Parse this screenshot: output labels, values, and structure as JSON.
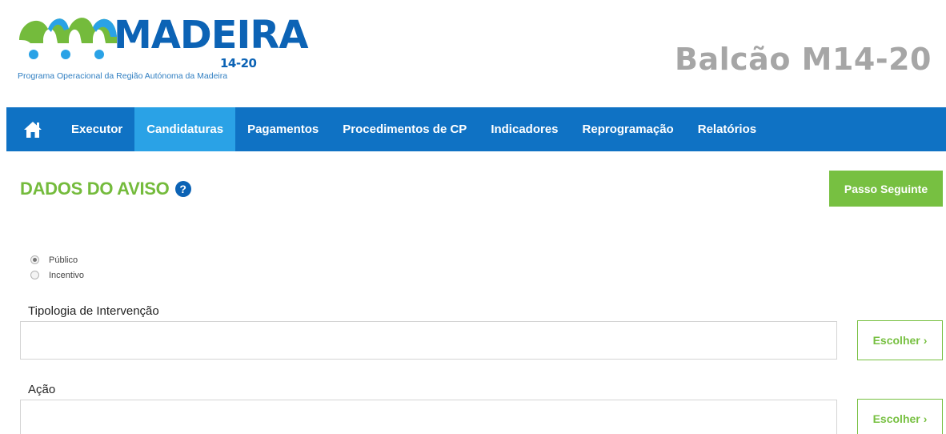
{
  "header": {
    "logo_text": "MADEIRA",
    "logo_years": "14-20",
    "logo_subtitle": "Programa Operacional da Região Autónoma da Madeira",
    "app_title": "Balcão M14-20"
  },
  "nav": {
    "items": [
      {
        "label": "Executor"
      },
      {
        "label": "Candidaturas",
        "active": true
      },
      {
        "label": "Pagamentos"
      },
      {
        "label": "Procedimentos de CP"
      },
      {
        "label": "Indicadores"
      },
      {
        "label": "Reprogramação"
      },
      {
        "label": "Relatórios"
      }
    ]
  },
  "section": {
    "title": "DADOS DO AVISO",
    "help_glyph": "?",
    "next_button": "Passo Seguinte"
  },
  "radios": [
    {
      "label": "Público",
      "checked": true
    },
    {
      "label": "Incentivo",
      "checked": false
    }
  ],
  "fields": [
    {
      "label": "Tipologia de Intervenção",
      "value": "",
      "button": "Escolher"
    },
    {
      "label": "Ação",
      "value": "",
      "button": "Escolher"
    }
  ],
  "colors": {
    "nav_bg": "#0f72c4",
    "nav_active": "#2aa2e6",
    "accent_green": "#77c041",
    "brand_blue": "#0c63b5",
    "title_grey": "#a6a6a6"
  }
}
